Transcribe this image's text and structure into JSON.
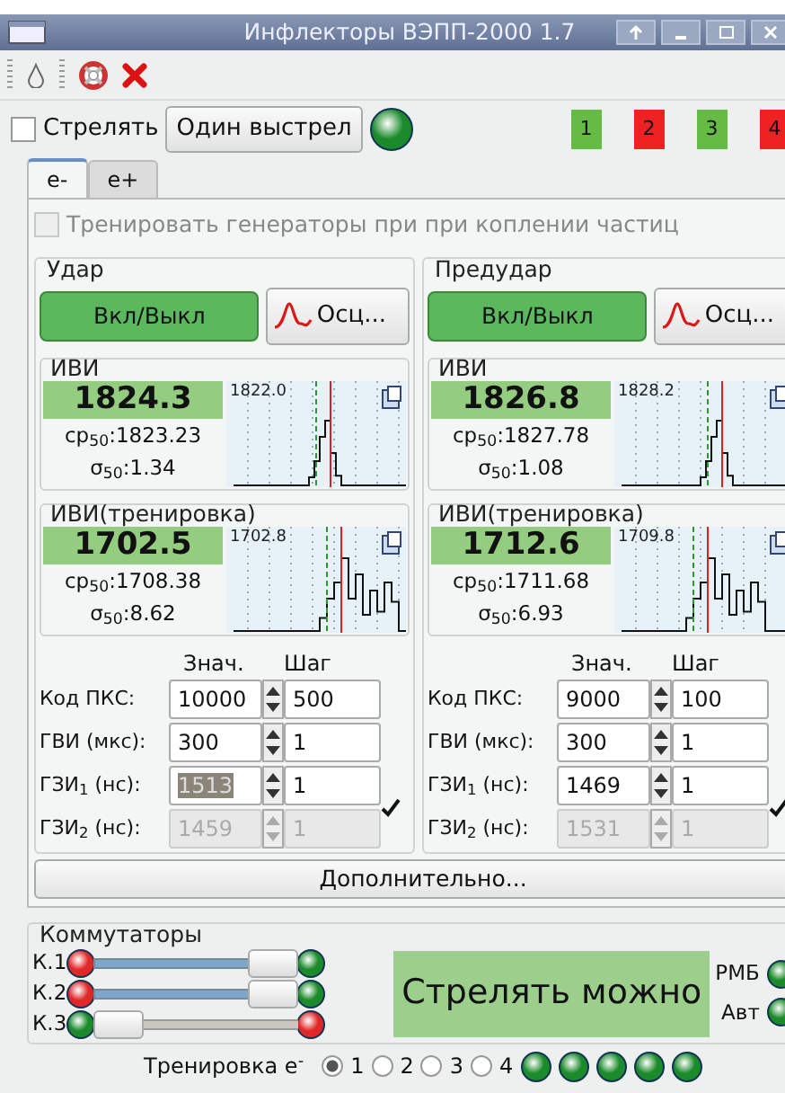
{
  "window": {
    "title": "Инфлекторы ВЭПП-2000 1.7"
  },
  "fire_row": {
    "fire_checkbox": {
      "label": "Стрелять",
      "checked": false
    },
    "single_shot": "Один выстрел",
    "led": {
      "on": true
    },
    "indicators": [
      {
        "label": "1",
        "color": "#66bb44"
      },
      {
        "label": "2",
        "color": "#ee2222"
      },
      {
        "label": "3",
        "color": "#66bb44"
      },
      {
        "label": "4",
        "color": "#ee2222"
      }
    ]
  },
  "tabs": [
    {
      "label": "e-",
      "selected": true
    },
    {
      "label": "e+",
      "selected": false
    }
  ],
  "train_checkbox": {
    "label": "Тренировать генераторы при при коплении частиц",
    "checked": false,
    "disabled": true
  },
  "channels": [
    {
      "title": "Удар",
      "toggle": {
        "label": "Вкл/Выкл",
        "on": true
      },
      "scope_button": "Осц...",
      "meters": [
        {
          "title": "ИВИ",
          "value": "1824.3",
          "mean": "ср$_{50}$:1823.23",
          "sigma": "σ$_{50}$:1.34",
          "hist_label": "1822.0"
        },
        {
          "title": "ИВИ(тренировка)",
          "value": "1702.5",
          "mean": "ср$_{50}$:1708.38",
          "sigma": "σ$_{50}$:8.62",
          "hist_label": "1702.8"
        }
      ],
      "headers": [
        "Знач.",
        "Шаг"
      ],
      "rows": [
        {
          "label": "Код ПКС:",
          "value": "10000",
          "step": "500",
          "disabled": false,
          "text_selected": false
        },
        {
          "label": "ГВИ (мкс):",
          "value": "300",
          "step": "1",
          "disabled": false,
          "text_selected": false
        },
        {
          "label": "ГЗИ$_{1}$ (нс):",
          "value": "1513",
          "step": "1",
          "disabled": false,
          "text_selected": true
        },
        {
          "label": "ГЗИ$_{2}$ (нс):",
          "value": "1459",
          "step": "1",
          "disabled": true,
          "text_selected": false
        }
      ],
      "link_checked": true
    },
    {
      "title": "Предудар",
      "toggle": {
        "label": "Вкл/Выкл",
        "on": true
      },
      "scope_button": "Осц...",
      "meters": [
        {
          "title": "ИВИ",
          "value": "1826.8",
          "mean": "ср$_{50}$:1827.78",
          "sigma": "σ$_{50}$:1.08",
          "hist_label": "1828.2"
        },
        {
          "title": "ИВИ(тренировка)",
          "value": "1712.6",
          "mean": "ср$_{50}$:1711.68",
          "sigma": "σ$_{50}$:6.93",
          "hist_label": "1709.8"
        }
      ],
      "headers": [
        "Знач.",
        "Шаг"
      ],
      "rows": [
        {
          "label": "Код ПКС:",
          "value": "9000",
          "step": "100",
          "disabled": false,
          "text_selected": false
        },
        {
          "label": "ГВИ (мкс):",
          "value": "300",
          "step": "1",
          "disabled": false,
          "text_selected": false
        },
        {
          "label": "ГЗИ$_{1}$ (нс):",
          "value": "1469",
          "step": "1",
          "disabled": false,
          "text_selected": false
        },
        {
          "label": "ГЗИ$_{2}$ (нс):",
          "value": "1531",
          "step": "1",
          "disabled": true,
          "text_selected": false
        }
      ],
      "link_checked": true
    }
  ],
  "more_button": "Дополнительно...",
  "switches": {
    "title": "Коммутаторы",
    "items": [
      {
        "label": "К.1",
        "level": 1
      },
      {
        "label": "К.2",
        "level": 1
      },
      {
        "label": "К.3",
        "level": 0
      }
    ]
  },
  "status": {
    "text": "Стрелять можно",
    "ok": true
  },
  "flags": [
    {
      "label": "РМБ",
      "on": true
    },
    {
      "label": "Авт",
      "on": true
    }
  ],
  "training": {
    "label": "Тренировка e$^{-}$",
    "options": [
      {
        "label": "1",
        "selected": true
      },
      {
        "label": "2",
        "selected": false
      },
      {
        "label": "3",
        "selected": false
      },
      {
        "label": "4",
        "selected": false
      }
    ],
    "leds": [
      {
        "on": true
      },
      {
        "on": true
      },
      {
        "on": true
      },
      {
        "on": true
      },
      {
        "on": true
      }
    ]
  }
}
